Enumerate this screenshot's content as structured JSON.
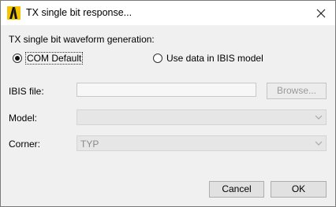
{
  "window": {
    "title": "TX single bit response..."
  },
  "form": {
    "section_label": "TX single bit waveform generation:",
    "radio_com_default": "COM Default",
    "radio_ibis": "Use data in IBIS model",
    "ibis_file_label": "IBIS file:",
    "ibis_file_value": "",
    "browse_label": "Browse...",
    "model_label": "Model:",
    "model_value": "",
    "corner_label": "Corner:",
    "corner_value": "TYP"
  },
  "footer": {
    "cancel_label": "Cancel",
    "ok_label": "OK"
  },
  "colors": {
    "logo_yellow": "#f5c400",
    "logo_black": "#111111"
  }
}
